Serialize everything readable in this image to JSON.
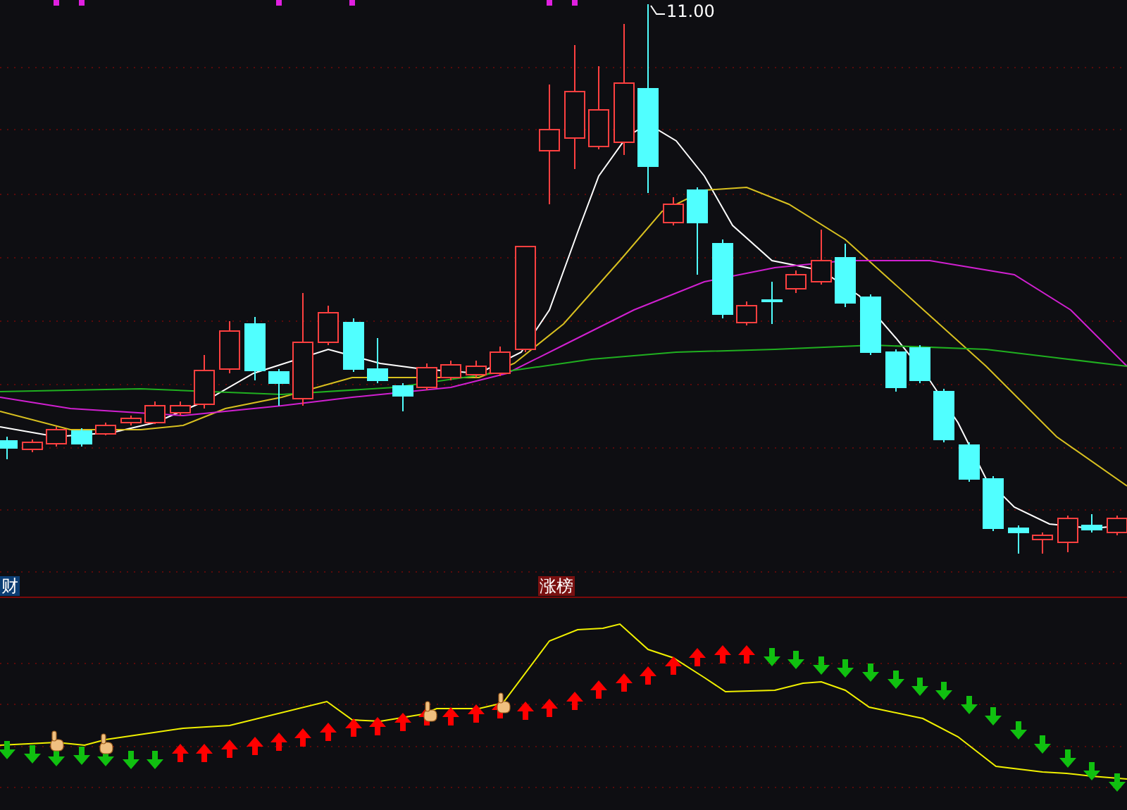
{
  "price_chart": {
    "peak_label": "11.00"
  },
  "indicator_panel": {
    "tags": [
      {
        "text": "财",
        "color": "#0b3d73"
      },
      {
        "text": "涨榜",
        "color": "#7a1010"
      }
    ]
  }
}
